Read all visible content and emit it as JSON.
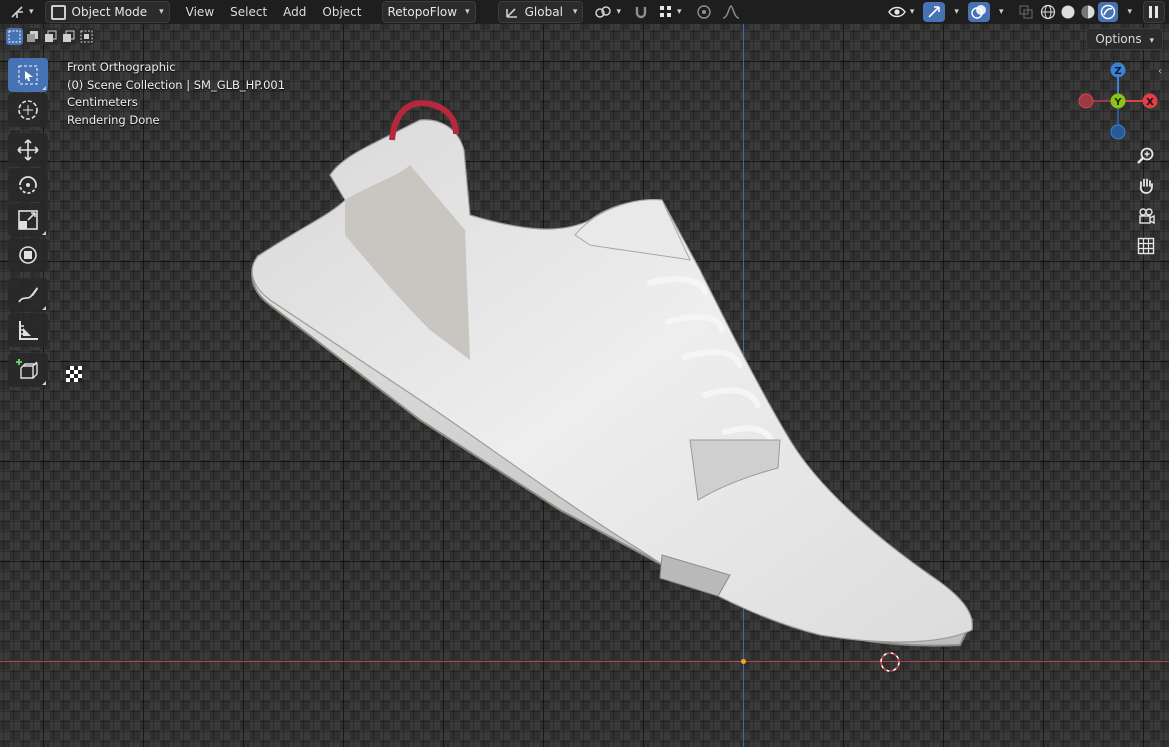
{
  "header": {
    "mode_label": "Object Mode",
    "menus": [
      "View",
      "Select",
      "Add",
      "Object"
    ],
    "addon_menu": "RetopoFlow",
    "transform_orientation": "Global"
  },
  "options_label": "Options",
  "viewport_info": {
    "view_name": "Front Orthographic",
    "collection": "(0) Scene Collection | SM_GLB_HP.001",
    "units": "Centimeters",
    "status": "Rendering Done"
  },
  "gizmo": {
    "z": "Z",
    "y": "Y",
    "x": "X"
  },
  "colors": {
    "accent": "#4772b3",
    "x_axis": "#e0404a",
    "y_axis": "#8cc21a",
    "z_axis": "#3b82d6",
    "header_bg": "#1e1e1e"
  },
  "toolbar_icons": [
    "tweak-select-icon",
    "cursor-icon",
    "move-icon",
    "rotate-icon",
    "scale-icon",
    "transform-icon",
    "annotate-icon",
    "measure-icon",
    "add-cube-icon"
  ],
  "navigation_icons": [
    "zoom-icon",
    "hand-pan-icon",
    "camera-icon",
    "ortho-grid-icon"
  ]
}
